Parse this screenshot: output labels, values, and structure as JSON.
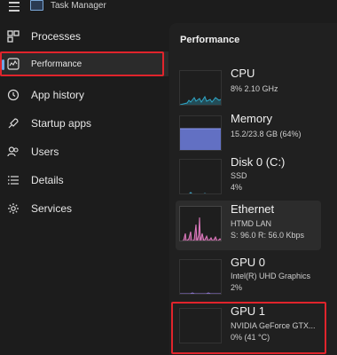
{
  "window": {
    "title": "Task Manager"
  },
  "nav": {
    "items": [
      {
        "label": "Processes",
        "icon": "processes-icon"
      },
      {
        "label": "Performance",
        "icon": "performance-icon"
      },
      {
        "label": "App history",
        "icon": "app-history-icon"
      },
      {
        "label": "Startup apps",
        "icon": "startup-apps-icon"
      },
      {
        "label": "Users",
        "icon": "users-icon"
      },
      {
        "label": "Details",
        "icon": "details-icon"
      },
      {
        "label": "Services",
        "icon": "services-icon"
      }
    ],
    "selected": "Performance"
  },
  "panel": {
    "title": "Performance",
    "cards": [
      {
        "name": "CPU",
        "lines": [
          "8%  2.10 GHz"
        ],
        "color": "#2fa7c7"
      },
      {
        "name": "Memory",
        "lines": [
          "15.2/23.8 GB (64%)"
        ],
        "color": "#6f7fe0"
      },
      {
        "name": "Disk 0 (C:)",
        "lines": [
          "SSD",
          "4%"
        ],
        "color": "#3fa0c0"
      },
      {
        "name": "Ethernet",
        "lines": [
          "HTMD LAN",
          "S: 96.0  R: 56.0 Kbps"
        ],
        "color": "#d46fb0"
      },
      {
        "name": "GPU 0",
        "lines": [
          "Intel(R) UHD Graphics",
          "2%"
        ],
        "color": "#8a70d6"
      },
      {
        "name": "GPU 1",
        "lines": [
          "NVIDIA GeForce GTX...",
          "0%  (41 °C)"
        ],
        "color": "#8a70d6"
      }
    ],
    "selected": "Ethernet"
  }
}
